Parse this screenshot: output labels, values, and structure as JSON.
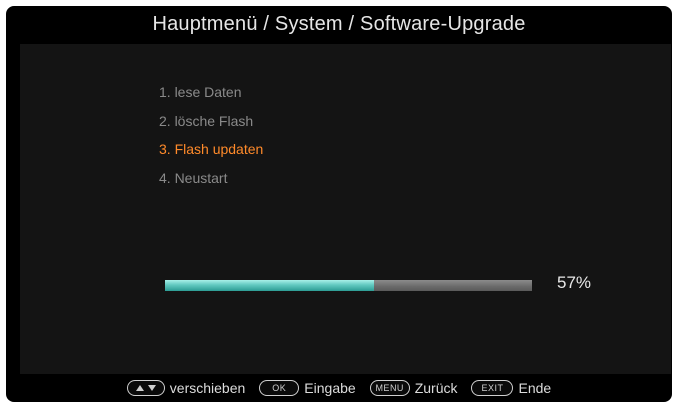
{
  "header": {
    "title": "Hauptmenü / System / Software-Upgrade"
  },
  "steps": [
    {
      "label": "1. lese Daten",
      "state": "done"
    },
    {
      "label": "2. lösche Flash",
      "state": "done"
    },
    {
      "label": "3. Flash updaten",
      "state": "active"
    },
    {
      "label": "4. Neustart",
      "state": "pending"
    }
  ],
  "progress": {
    "value": 57,
    "label": "57%"
  },
  "footer": {
    "hints": [
      {
        "key": "▲▼",
        "key_icon": "up-down-arrows-icon",
        "label": "verschieben"
      },
      {
        "key": "OK",
        "label": "Eingabe"
      },
      {
        "key": "MENU",
        "label": "Zurück"
      },
      {
        "key": "EXIT",
        "label": "Ende"
      }
    ]
  },
  "colors": {
    "active_step": "#ff8a2a",
    "inactive_step": "#8a8a8a",
    "progress_fill": "#62c9c0",
    "progress_track": "#6a6a6a"
  }
}
